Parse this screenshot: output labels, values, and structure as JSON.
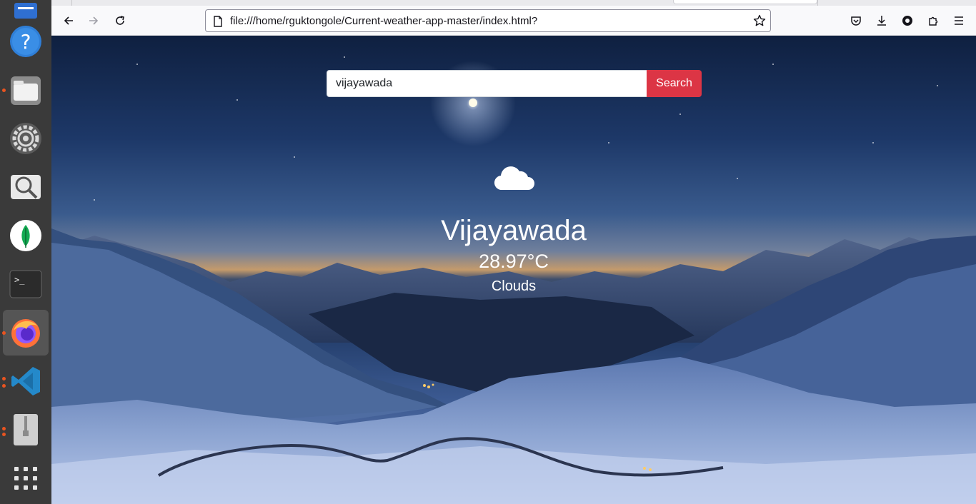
{
  "browser": {
    "url": "file:///home/rguktongole/Current-weather-app-master/index.html?",
    "icons": {
      "back": "arrow-left-icon",
      "forward": "arrow-right-icon",
      "reload": "reload-icon",
      "page": "page-icon",
      "bookmark": "star-icon",
      "pocket": "pocket-icon",
      "downloads": "download-icon",
      "account": "account-icon",
      "extensions": "puzzle-icon",
      "menu": "hamburger-icon"
    }
  },
  "dock": {
    "items": [
      "help",
      "files",
      "settings",
      "image-viewer",
      "mongodb",
      "terminal",
      "firefox",
      "vscode",
      "archive-manager",
      "show-apps"
    ],
    "active": "firefox",
    "accent": "#e95420"
  },
  "search": {
    "value": "vijayawada",
    "button_label": "Search",
    "button_color": "#dc3545"
  },
  "weather": {
    "icon": "cloud-icon",
    "city": "Vijayawada",
    "temperature": "28.97°C",
    "condition": "Clouds"
  }
}
